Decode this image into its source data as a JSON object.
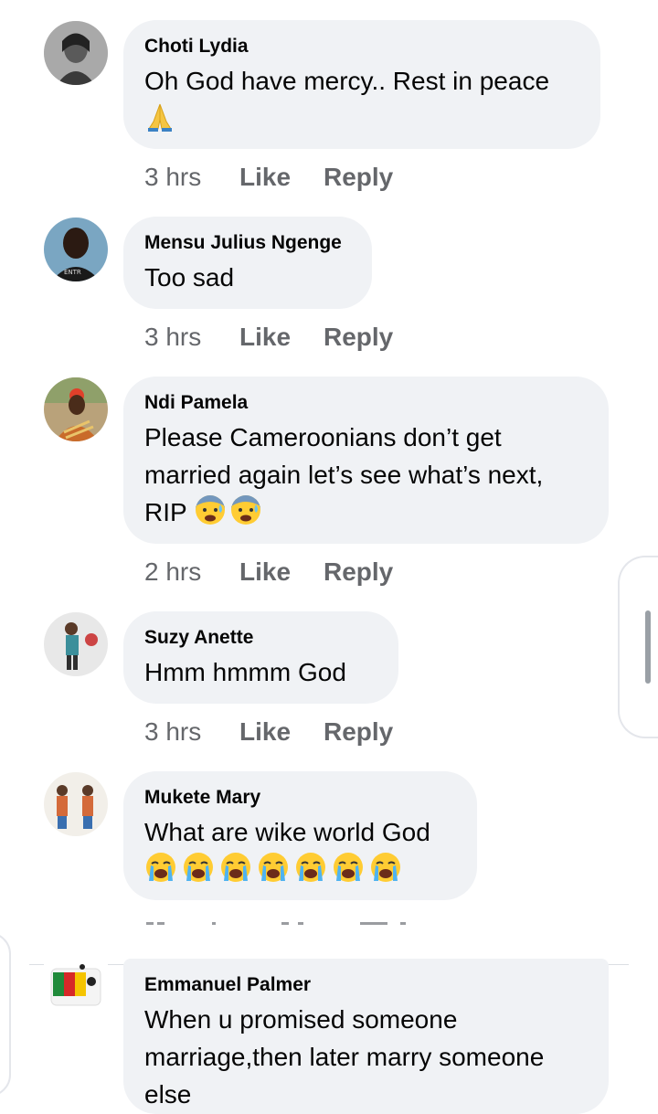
{
  "comments": [
    {
      "name": "Choti Lydia",
      "text": "Oh God have mercy.. Rest in peace",
      "emojis": [
        "folded-hands"
      ],
      "time": "3 hrs",
      "like": "Like",
      "reply": "Reply"
    },
    {
      "name": "Mensu Julius Ngenge",
      "text": "Too sad",
      "time": "3 hrs",
      "like": "Like",
      "reply": "Reply"
    },
    {
      "name": "Ndi Pamela",
      "text_line1": "Please Cameroonians don’t get",
      "text_line2": "married again let’s see what’s next,",
      "text_line3": "RIP",
      "emojis": [
        "anxious-face-with-sweat",
        "anxious-face-with-sweat"
      ],
      "time": "2 hrs",
      "like": "Like",
      "reply": "Reply"
    },
    {
      "name": "Suzy Anette",
      "text": "Hmm hmmm God",
      "time": "3 hrs",
      "like": "Like",
      "reply": "Reply"
    },
    {
      "name": "Mukete Mary",
      "text": "What are wike world God",
      "emojis": [
        "crying-face",
        "crying-face",
        "crying-face",
        "crying-face",
        "crying-face",
        "crying-face",
        "crying-face"
      ],
      "like": "Like",
      "reply": "Reply"
    },
    {
      "name": "Emmanuel Palmer",
      "text_line1": "When u promised someone",
      "text_line2": "marriage,then later marry someone",
      "text_line3": "else"
    }
  ],
  "colors": {
    "bubble": "#f0f2f5",
    "meta": "#65676b",
    "text": "#050505"
  }
}
